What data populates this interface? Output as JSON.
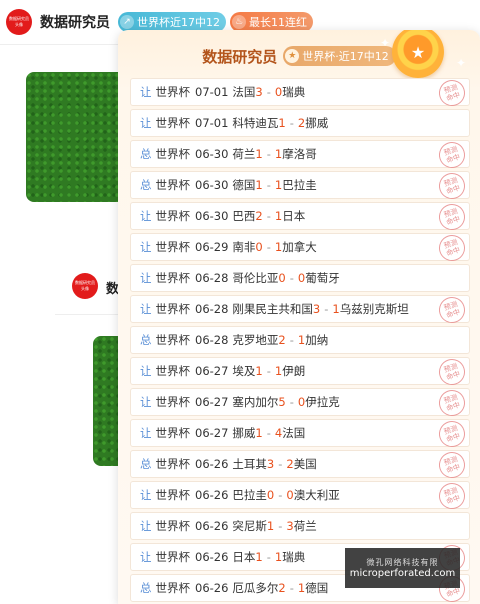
{
  "header": {
    "avatar_text": [
      "数据研究员",
      "头像"
    ],
    "name": "数据研究员",
    "badge_streak": "世界杯近17中12",
    "badge_longest": "最长11连红"
  },
  "feed": {
    "author_name": "数"
  },
  "popup": {
    "title": "数据研究员",
    "badge": "世界杯·近17中12",
    "rows": [
      {
        "type": "让",
        "league": "世界杯",
        "date": "07-01",
        "home": "法国",
        "hs": "3",
        "as": "0",
        "away": "瑞典",
        "stamp": true
      },
      {
        "type": "让",
        "league": "世界杯",
        "date": "07-01",
        "home": "科特迪瓦",
        "hs": "1",
        "as": "2",
        "away": "挪威",
        "stamp": false
      },
      {
        "type": "总",
        "league": "世界杯",
        "date": "06-30",
        "home": "荷兰",
        "hs": "1",
        "as": "1",
        "away": "摩洛哥",
        "stamp": true
      },
      {
        "type": "总",
        "league": "世界杯",
        "date": "06-30",
        "home": "德国",
        "hs": "1",
        "as": "1",
        "away": "巴拉圭",
        "stamp": true
      },
      {
        "type": "让",
        "league": "世界杯",
        "date": "06-30",
        "home": "巴西",
        "hs": "2",
        "as": "1",
        "away": "日本",
        "stamp": true
      },
      {
        "type": "让",
        "league": "世界杯",
        "date": "06-29",
        "home": "南非",
        "hs": "0",
        "as": "1",
        "away": "加拿大",
        "stamp": true
      },
      {
        "type": "让",
        "league": "世界杯",
        "date": "06-28",
        "home": "哥伦比亚",
        "hs": "0",
        "as": "0",
        "away": "葡萄牙",
        "stamp": false
      },
      {
        "type": "让",
        "league": "世界杯",
        "date": "06-28",
        "home": "刚果民主共和国",
        "hs": "3",
        "as": "1",
        "away": "乌兹别克斯坦",
        "stamp": true
      },
      {
        "type": "总",
        "league": "世界杯",
        "date": "06-28",
        "home": "克罗地亚",
        "hs": "2",
        "as": "1",
        "away": "加纳",
        "stamp": false
      },
      {
        "type": "让",
        "league": "世界杯",
        "date": "06-27",
        "home": "埃及",
        "hs": "1",
        "as": "1",
        "away": "伊朗",
        "stamp": true
      },
      {
        "type": "让",
        "league": "世界杯",
        "date": "06-27",
        "home": "塞内加尔",
        "hs": "5",
        "as": "0",
        "away": "伊拉克",
        "stamp": true
      },
      {
        "type": "让",
        "league": "世界杯",
        "date": "06-27",
        "home": "挪威",
        "hs": "1",
        "as": "4",
        "away": "法国",
        "stamp": true
      },
      {
        "type": "总",
        "league": "世界杯",
        "date": "06-26",
        "home": "土耳其",
        "hs": "3",
        "as": "2",
        "away": "美国",
        "stamp": true
      },
      {
        "type": "让",
        "league": "世界杯",
        "date": "06-26",
        "home": "巴拉圭",
        "hs": "0",
        "as": "0",
        "away": "澳大利亚",
        "stamp": true
      },
      {
        "type": "让",
        "league": "世界杯",
        "date": "06-26",
        "home": "突尼斯",
        "hs": "1",
        "as": "3",
        "away": "荷兰",
        "stamp": false
      },
      {
        "type": "让",
        "league": "世界杯",
        "date": "06-26",
        "home": "日本",
        "hs": "1",
        "as": "1",
        "away": "瑞典",
        "stamp": true
      },
      {
        "type": "总",
        "league": "世界杯",
        "date": "06-26",
        "home": "厄瓜多尔",
        "hs": "2",
        "as": "1",
        "away": "德国",
        "stamp": true
      }
    ],
    "stamp_text": [
      "预测",
      "命中"
    ]
  },
  "watermark": {
    "line1": "微孔网络科技有限",
    "line2": "microperforated.com"
  },
  "colors": {
    "score": "#e8511e",
    "type_label": "#5a8fd6",
    "popup_title": "#b3541b",
    "badge_blue": "#47b8d6",
    "badge_orange": "#f57a45"
  },
  "icons": {
    "badge_streak": "trend-icon",
    "badge_longest": "flame-icon",
    "medal": "star-medal-icon",
    "stamp": "hit-stamp-icon"
  }
}
